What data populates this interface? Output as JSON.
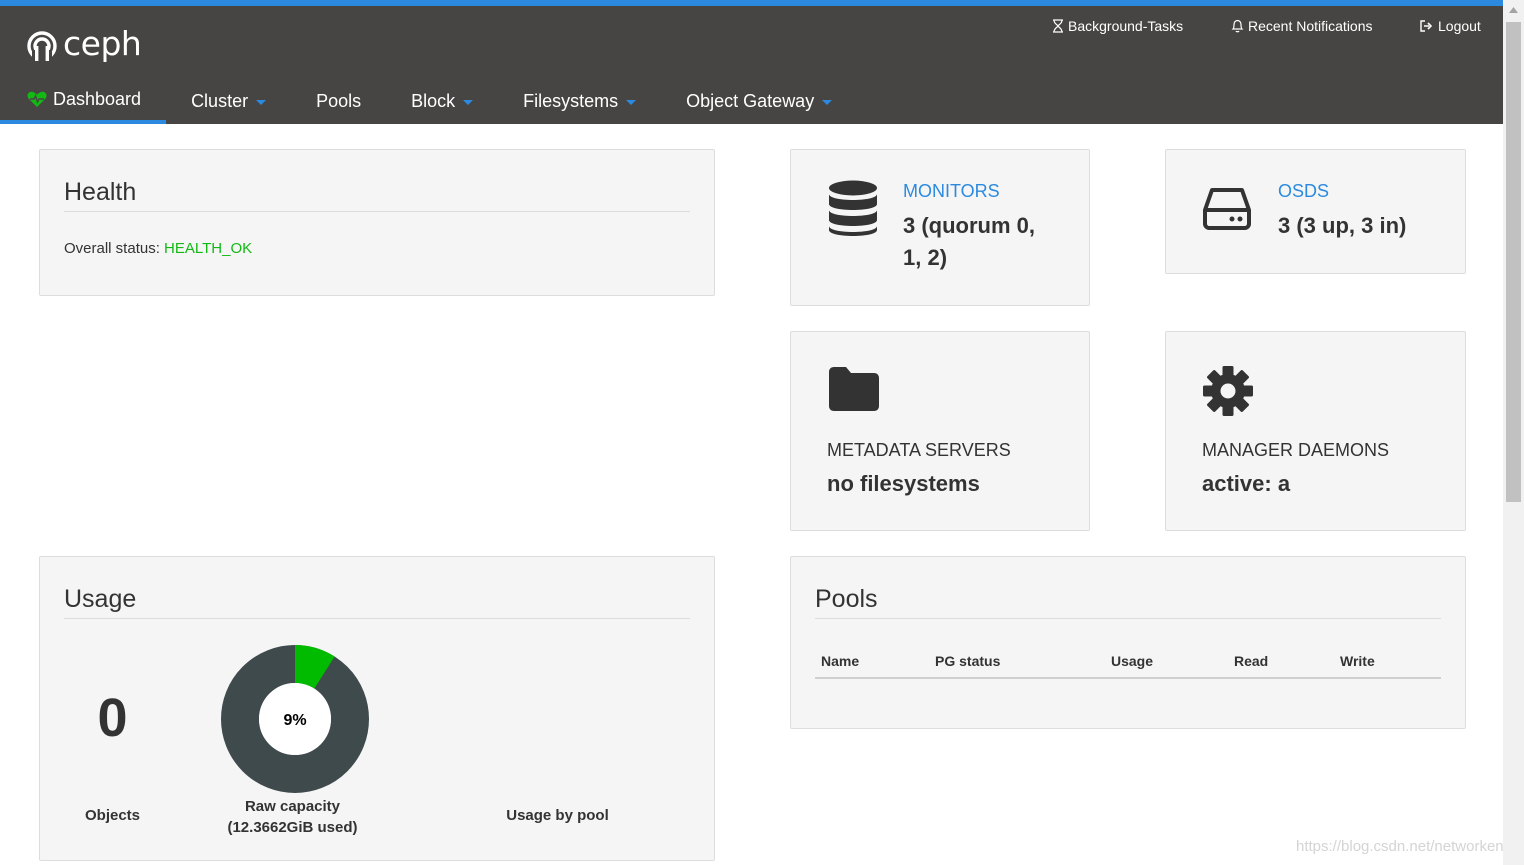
{
  "brand": {
    "name": "ceph"
  },
  "header_links": {
    "background_tasks": "Background-Tasks",
    "notifications": "Recent Notifications",
    "logout": "Logout"
  },
  "nav": {
    "dashboard": "Dashboard",
    "cluster": "Cluster",
    "pools": "Pools",
    "block": "Block",
    "filesystems": "Filesystems",
    "object_gateway": "Object Gateway"
  },
  "health": {
    "title": "Health",
    "status_label": "Overall status:",
    "status_value": "HEALTH_OK"
  },
  "monitors": {
    "label": "MONITORS",
    "value_line1": "3 (quorum 0,",
    "value_line2": "1, 2)"
  },
  "osds": {
    "label": "OSDS",
    "value": "3 (3 up, 3 in)"
  },
  "metadata": {
    "label": "METADATA SERVERS",
    "value": "no filesystems"
  },
  "manager": {
    "label": "MANAGER DAEMONS",
    "value": "active: a"
  },
  "usage": {
    "title": "Usage",
    "objects_count": "0",
    "objects_label": "Objects",
    "raw_percent_label": "9%",
    "raw_percent": 9,
    "raw_label": "Raw capacity",
    "raw_used": "(12.3662GiB used)",
    "by_pool_label": "Usage by pool"
  },
  "pools": {
    "title": "Pools",
    "columns": [
      "Name",
      "PG status",
      "Usage",
      "Read",
      "Write"
    ]
  },
  "watermark": "https://blog.csdn.net/networken",
  "colors": {
    "accent": "#2b8adf",
    "ok": "#13b913",
    "navbar": "#474544",
    "donut_used": "#00bb00",
    "donut_free": "#3f4a4c"
  }
}
